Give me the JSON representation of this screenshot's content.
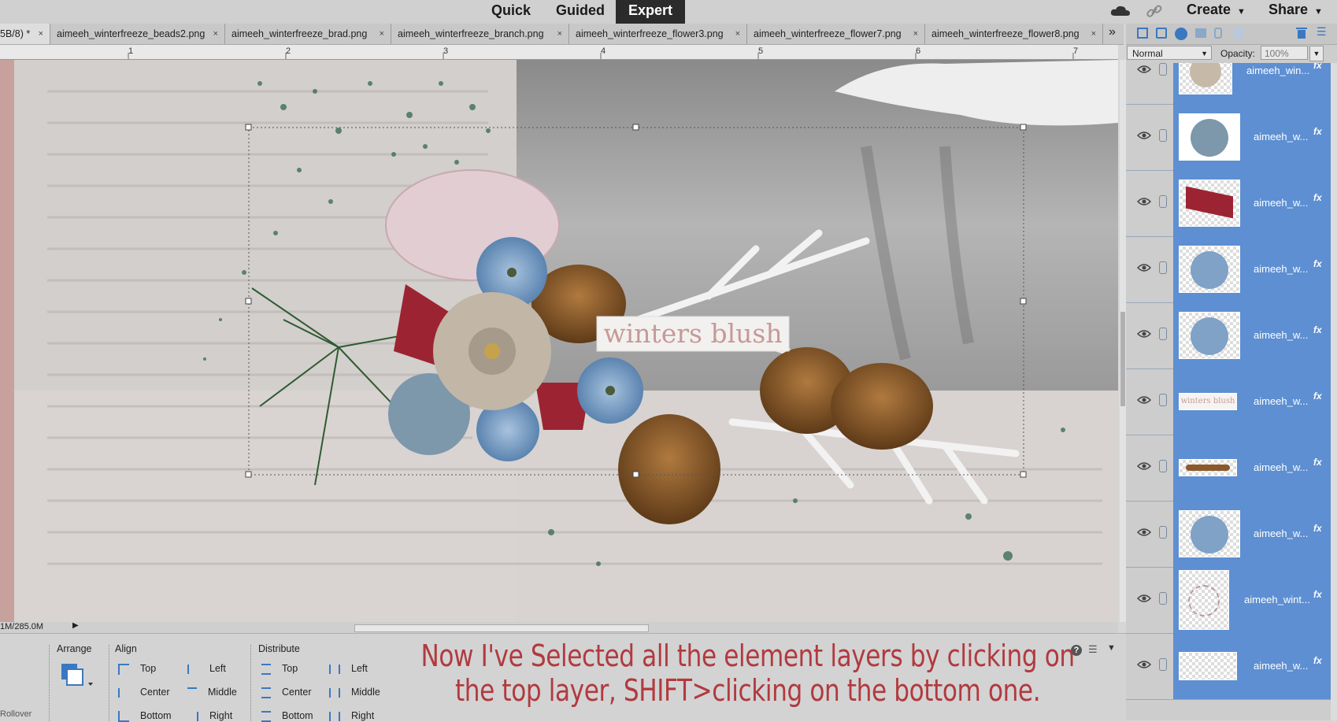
{
  "modes": {
    "quick": "Quick",
    "guided": "Guided",
    "expert": "Expert"
  },
  "top_actions": {
    "create": "Create",
    "share": "Share"
  },
  "tabs": [
    {
      "label": "5B/8) *",
      "active": true
    },
    {
      "label": "aimeeh_winterfreeze_beads2.png"
    },
    {
      "label": "aimeeh_winterfreeze_brad.png"
    },
    {
      "label": "aimeeh_winterfreeze_branch.png"
    },
    {
      "label": "aimeeh_winterfreeze_flower3.png"
    },
    {
      "label": "aimeeh_winterfreeze_flower7.png"
    },
    {
      "label": "aimeeh_winterfreeze_flower8.png"
    }
  ],
  "tab_close": "×",
  "tab_overflow": "»",
  "ruler": [
    "1",
    "2",
    "3",
    "4",
    "5",
    "6",
    "7"
  ],
  "canvas": {
    "title_tag": "winters blush"
  },
  "status": {
    "doc_size": "1M/285.0M"
  },
  "layers_panel": {
    "blend_mode": "Normal",
    "opacity_label": "Opacity:",
    "opacity_value": "100%",
    "layers": [
      {
        "name": "aimeeh_win...",
        "thumb": "flower-beige"
      },
      {
        "name": "aimeeh_w...",
        "thumb": "flower-blue-dahlia"
      },
      {
        "name": "aimeeh_w...",
        "thumb": "ribbon-red"
      },
      {
        "name": "aimeeh_w...",
        "thumb": "flower-blue"
      },
      {
        "name": "aimeeh_w...",
        "thumb": "flower-blue"
      },
      {
        "name": "aimeeh_w...",
        "thumb": "title-tag",
        "thumb_text": "winters blush"
      },
      {
        "name": "aimeeh_w...",
        "thumb": "pinecones-branch"
      },
      {
        "name": "aimeeh_w...",
        "thumb": "flower-blue"
      },
      {
        "name": "aimeeh_wint...",
        "thumb": "snowflake-pink"
      },
      {
        "name": "aimeeh_w...",
        "thumb": "sparkle"
      }
    ],
    "fx": "fx"
  },
  "options_bar": {
    "arrange": "Arrange",
    "align": "Align",
    "distribute": "Distribute",
    "align_items": {
      "top": "Top",
      "center": "Center",
      "bottom": "Bottom",
      "left": "Left",
      "middle": "Middle",
      "right": "Right"
    },
    "distribute_items": {
      "top": "Top",
      "center": "Center",
      "bottom": "Bottom",
      "left": "Left",
      "middle": "Middle",
      "right": "Right"
    },
    "rollover": "Rollover"
  },
  "caption": "Now I've Selected all the element layers by clicking on the top layer, SHIFT>clicking on the bottom one.",
  "colors": {
    "accent_selected": "#5d8fd2",
    "caption": "#b13a3f",
    "expert_bg": "#2b2b2b"
  }
}
